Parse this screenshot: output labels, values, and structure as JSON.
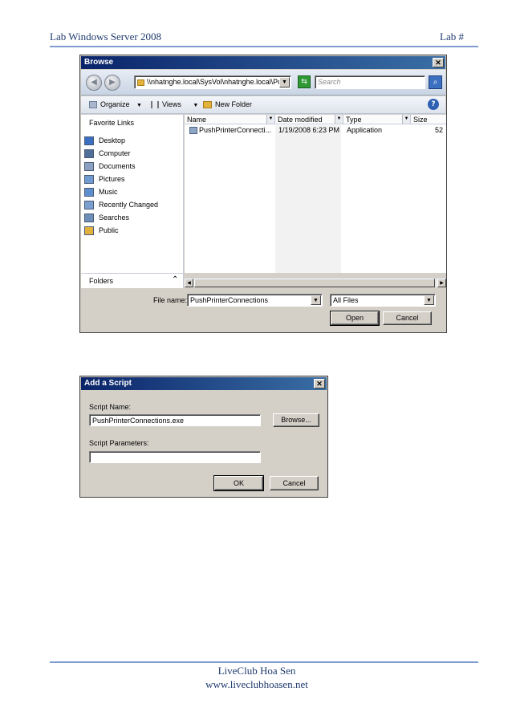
{
  "header": {
    "left": "Lab Windows Server 2008",
    "right": "Lab #"
  },
  "footer": {
    "line1": "LiveClub Hoa Sen",
    "line2": "www.liveclubhoasen.net"
  },
  "browse": {
    "title": "Browse",
    "close_glyph": "✕",
    "address": "\\\\nhatnghe.local\\SysVol\\nhatnghe.local\\Poli",
    "search_placeholder": "Search",
    "toolbar": {
      "organize": "Organize",
      "views": "Views",
      "new_folder": "New Folder",
      "help": "?"
    },
    "favorites_title": "Favorite Links",
    "favorites": [
      {
        "label": "Desktop",
        "icon": "desktop-icon",
        "color": "#3a6fc4"
      },
      {
        "label": "Computer",
        "icon": "computer-icon",
        "color": "#4f6f98"
      },
      {
        "label": "Documents",
        "icon": "documents-icon",
        "color": "#8aa1c2"
      },
      {
        "label": "Pictures",
        "icon": "pictures-icon",
        "color": "#6f9bd1"
      },
      {
        "label": "Music",
        "icon": "music-icon",
        "color": "#5d8fcf"
      },
      {
        "label": "Recently Changed",
        "icon": "recently-changed-icon",
        "color": "#7ba0cf"
      },
      {
        "label": "Searches",
        "icon": "searches-icon",
        "color": "#6d8fb8"
      },
      {
        "label": "Public",
        "icon": "public-folder-icon",
        "color": "#e3b23c"
      }
    ],
    "folders_label": "Folders",
    "columns": {
      "name": "Name",
      "date": "Date modified",
      "type": "Type",
      "size": "Size"
    },
    "files": [
      {
        "name": "PushPrinterConnecti...",
        "date": "1/19/2008 6:23 PM",
        "type": "Application",
        "size": "52"
      }
    ],
    "filename_label": "File name:",
    "filename_value": "PushPrinterConnections",
    "filetype_value": "All Files",
    "open_label": "Open",
    "cancel_label": "Cancel"
  },
  "addscript": {
    "title": "Add a Script",
    "close_glyph": "✕",
    "script_name_label": "Script Name:",
    "script_name_value": "PushPrinterConnections.exe",
    "browse_label": "Browse...",
    "params_label": "Script Parameters:",
    "params_value": "",
    "ok_label": "OK",
    "cancel_label": "Cancel"
  }
}
